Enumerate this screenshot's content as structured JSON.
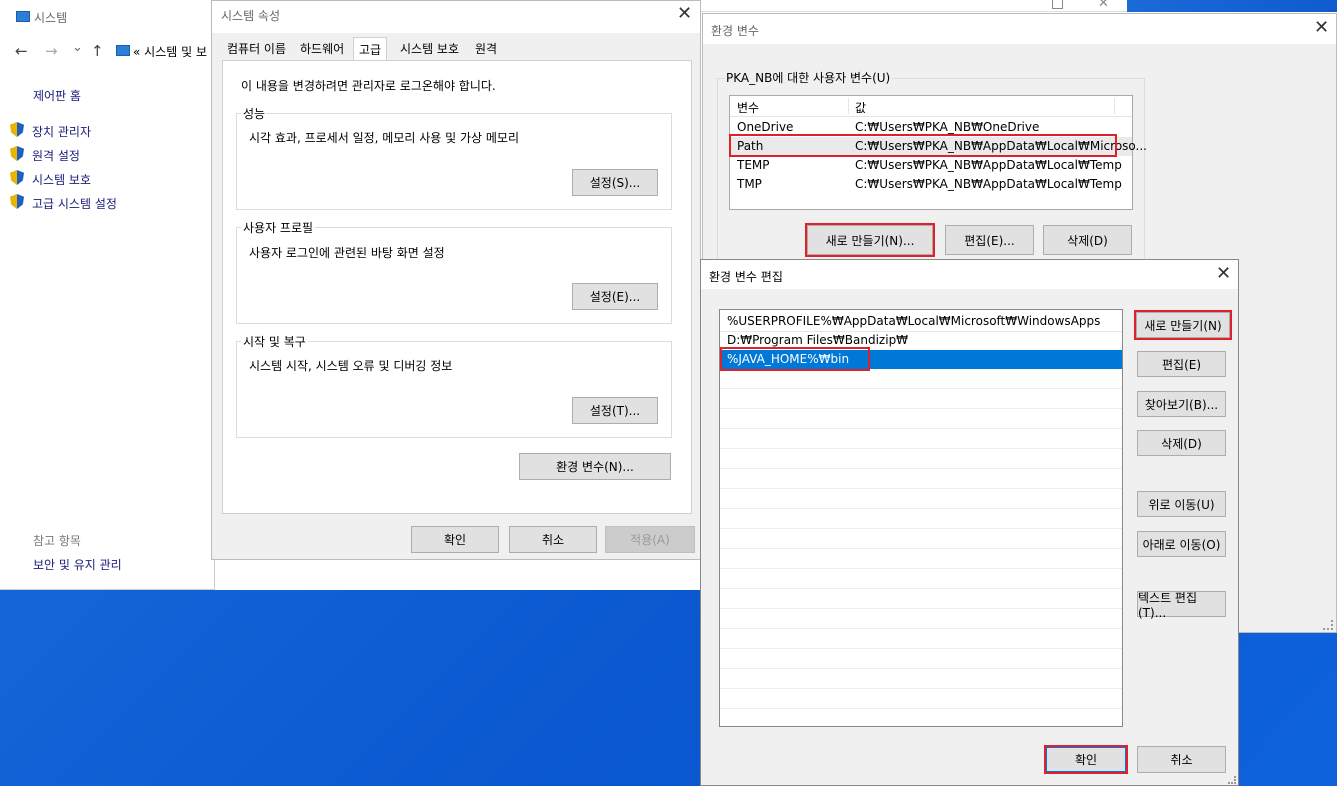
{
  "system": {
    "title": "시스템",
    "breadcrumb": "« 시스템 및 보",
    "nav_back": "←",
    "nav_forward": "→",
    "nav_dropdown": "⌄",
    "nav_up": "↑",
    "cp_home": "제어판 홈",
    "links": [
      "장치 관리자",
      "원격 설정",
      "시스템 보호",
      "고급 시스템 설정"
    ],
    "see_also": "참고 항목",
    "see_also_link": "보안 및 유지 관리"
  },
  "sysprops": {
    "title": "시스템 속성",
    "tabs": [
      "컴퓨터 이름",
      "하드웨어",
      "고급",
      "시스템 보호",
      "원격"
    ],
    "admin_note": "이 내용을 변경하려면 관리자로 로그온해야 합니다.",
    "performance": {
      "label": "성능",
      "desc": "시각 효과, 프로세서 일정, 메모리 사용 및 가상 메모리",
      "button": "설정(S)..."
    },
    "profile": {
      "label": "사용자 프로필",
      "desc": "사용자 로그인에 관련된 바탕 화면 설정",
      "button": "설정(E)..."
    },
    "startup": {
      "label": "시작 및 복구",
      "desc": "시스템 시작, 시스템 오류 및 디버깅 정보",
      "button": "설정(T)..."
    },
    "env_button": "환경 변수(N)...",
    "ok": "확인",
    "cancel": "취소",
    "apply": "적용(A)"
  },
  "envvars": {
    "title": "환경 변수",
    "user_group": "PKA_NB에 대한 사용자 변수(U)",
    "col_var": "변수",
    "col_val": "값",
    "rows": [
      {
        "name": "OneDrive",
        "value": "C:₩Users₩PKA_NB₩OneDrive"
      },
      {
        "name": "Path",
        "value": "C:₩Users₩PKA_NB₩AppData₩Local₩Microso..."
      },
      {
        "name": "TEMP",
        "value": "C:₩Users₩PKA_NB₩AppData₩Local₩Temp"
      },
      {
        "name": "TMP",
        "value": "C:₩Users₩PKA_NB₩AppData₩Local₩Temp"
      }
    ],
    "new": "새로 만들기(N)...",
    "edit": "편집(E)...",
    "delete": "삭제(D)"
  },
  "editenv": {
    "title": "환경 변수 편집",
    "items": [
      "%USERPROFILE%₩AppData₩Local₩Microsoft₩WindowsApps",
      "D:₩Program Files₩Bandizip₩",
      "%JAVA_HOME%₩bin"
    ],
    "new": "새로 만들기(N)",
    "edit": "편집(E)",
    "browse": "찾아보기(B)...",
    "delete": "삭제(D)",
    "move_up": "위로 이동(U)",
    "move_down": "아래로 이동(O)",
    "edit_text": "텍스트 편집(T)...",
    "ok": "확인",
    "cancel": "취소"
  },
  "close_glyph": "✕",
  "colors": {
    "highlight": "#e0202a",
    "selection": "#0078d7",
    "desktop": "#0a57cf"
  }
}
